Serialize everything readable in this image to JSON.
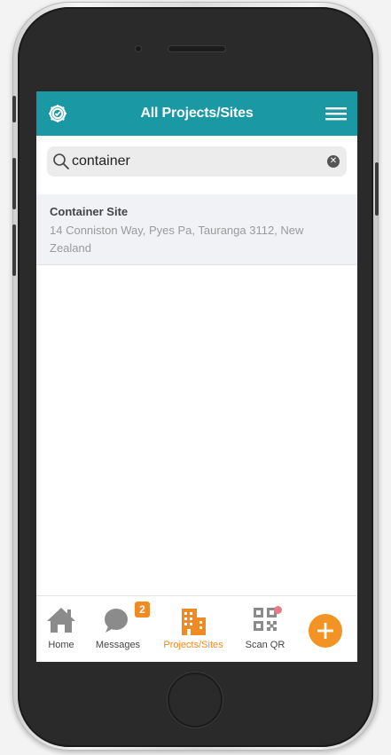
{
  "header": {
    "title": "All Projects/Sites",
    "left_icon": "settings-gear-icon",
    "right_icon": "hamburger-menu-icon",
    "background_color": "#1a99a5"
  },
  "search": {
    "value": "container",
    "clear_icon": "clear-x-icon"
  },
  "results": [
    {
      "name": "Container Site",
      "address": "14 Conniston Way, Pyes Pa, Tauranga 3112, New Zealand"
    }
  ],
  "tabs": [
    {
      "label": "Home",
      "icon": "home-icon",
      "active": false
    },
    {
      "label": "Messages",
      "icon": "chat-bubble-icon",
      "active": false,
      "badge": "2"
    },
    {
      "label": "Projects/Sites",
      "icon": "building-icon",
      "active": true
    },
    {
      "label": "Scan QR",
      "icon": "qr-code-icon",
      "active": false,
      "dot": true
    }
  ],
  "fab": {
    "icon": "plus-icon",
    "color": "#f39324"
  },
  "colors": {
    "accent": "#f18a22",
    "inactive": "#8b8b8b"
  }
}
